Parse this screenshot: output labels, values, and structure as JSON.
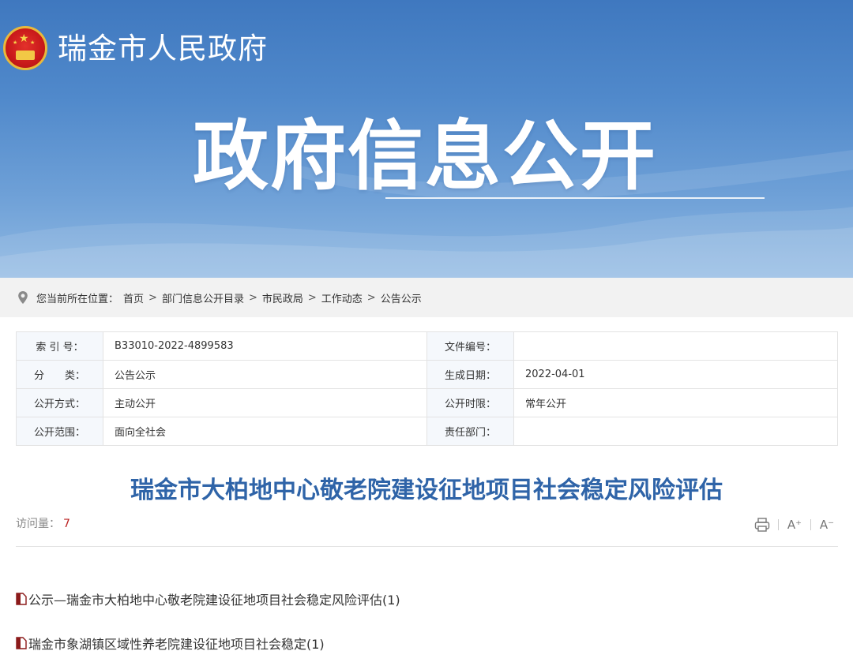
{
  "header": {
    "site_title": "瑞金市人民政府",
    "banner_title": "政府信息公开"
  },
  "breadcrumb": {
    "label": "您当前所在位置：",
    "items": [
      "首页",
      "部门信息公开目录",
      "市民政局",
      "工作动态",
      "公告公示"
    ],
    "separator": ">"
  },
  "meta": {
    "rows": [
      {
        "k1": "索 引 号：",
        "v1": "B33010-2022-4899583",
        "k2": "文件编号：",
        "v2": ""
      },
      {
        "k1": "分　　类：",
        "v1": "公告公示",
        "k2": "生成日期：",
        "v2": "2022-04-01"
      },
      {
        "k1": "公开方式：",
        "v1": "主动公开",
        "k2": "公开时限：",
        "v2": "常年公开"
      },
      {
        "k1": "公开范围：",
        "v1": "面向全社会",
        "k2": "责任部门：",
        "v2": ""
      }
    ]
  },
  "article": {
    "title": "瑞金市大柏地中心敬老院建设征地项目社会稳定风险评估",
    "visits_label": "访问量：",
    "visits_count": "7",
    "tools": {
      "increase_font": "A⁺",
      "decrease_font": "A⁻"
    }
  },
  "attachments": [
    "公示—瑞金市大柏地中心敬老院建设征地项目社会稳定风险评估(1)",
    "瑞金市象湖镇区域性养老院建设征地项目社会稳定(1)"
  ],
  "colors": {
    "banner_top": "#3f78bf",
    "banner_bottom": "#8fb8e2",
    "title_blue": "#2f64a8",
    "visits_red": "#b22222"
  }
}
